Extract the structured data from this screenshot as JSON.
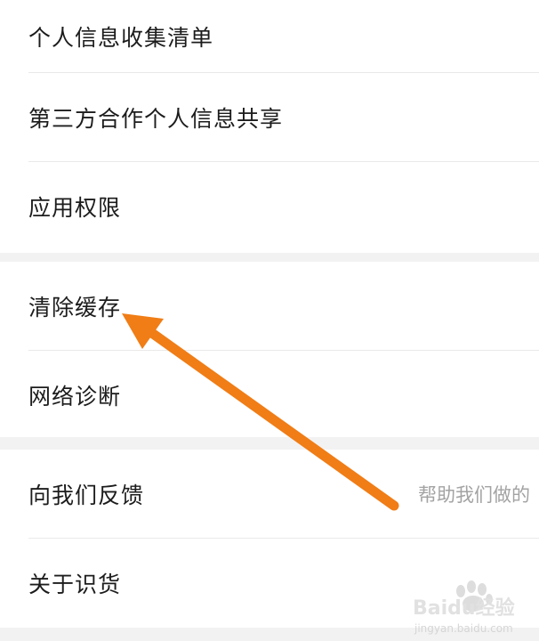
{
  "settings": {
    "group1": [
      {
        "label": "个人信息收集清单"
      },
      {
        "label": "第三方合作个人信息共享"
      },
      {
        "label": "应用权限"
      }
    ],
    "group2": [
      {
        "label": "清除缓存"
      },
      {
        "label": "网络诊断"
      }
    ],
    "group3": [
      {
        "label": "向我们反馈",
        "sub": "帮助我们做的"
      },
      {
        "label": "关于识货"
      }
    ]
  },
  "annotation": {
    "arrow_color": "#f07d16",
    "points_to": "清除缓存"
  },
  "watermark": {
    "brand": "Baidu经验",
    "domain": "jingyan.baidu.com"
  }
}
